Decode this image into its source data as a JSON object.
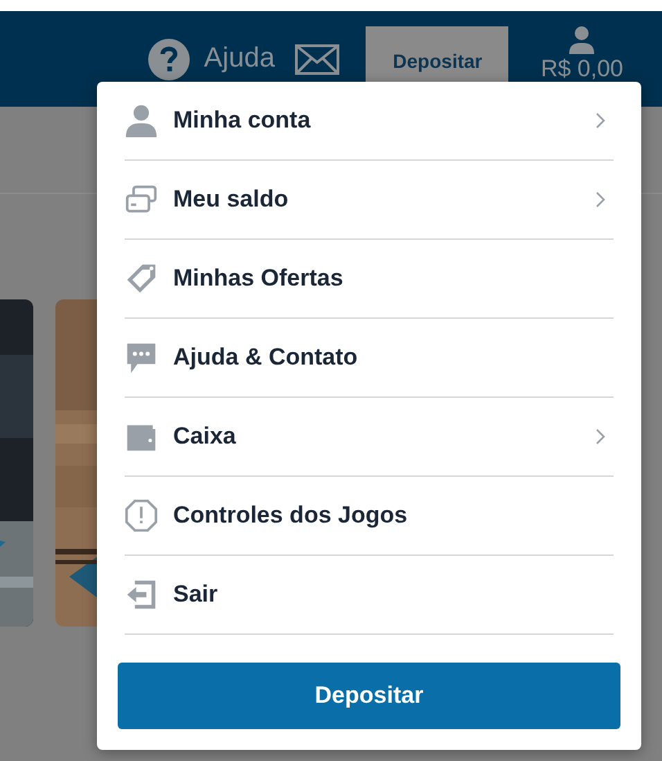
{
  "header": {
    "help_label": "Ajuda",
    "deposit_button": "Depositar",
    "balance": "R$ 0,00"
  },
  "menu": {
    "items": [
      {
        "label": "Minha conta",
        "has_submenu": true
      },
      {
        "label": "Meu saldo",
        "has_submenu": true
      },
      {
        "label": "Minhas Ofertas",
        "has_submenu": false
      },
      {
        "label": "Ajuda & Contato",
        "has_submenu": false
      },
      {
        "label": "Caixa",
        "has_submenu": true
      },
      {
        "label": "Controles dos Jogos",
        "has_submenu": false
      },
      {
        "label": "Sair",
        "has_submenu": false
      }
    ],
    "deposit_button": "Depositar"
  }
}
